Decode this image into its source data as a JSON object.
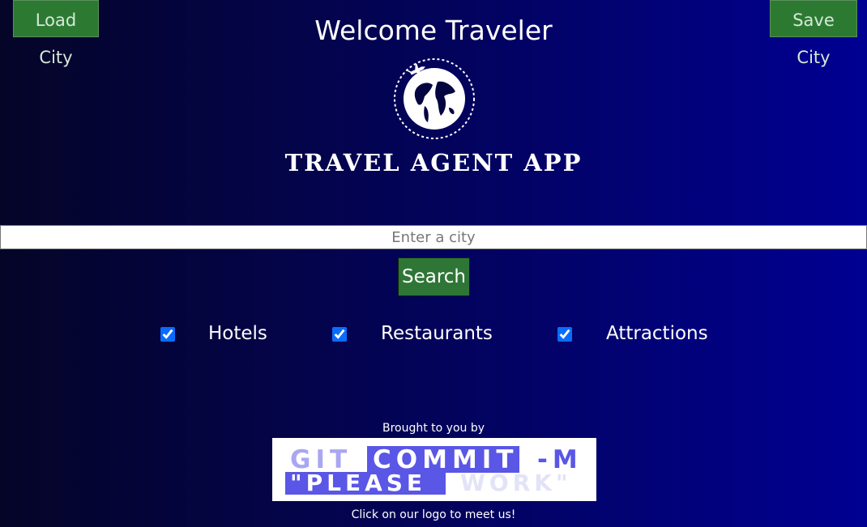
{
  "header": {
    "load_label": "Load City",
    "save_label": "Save City",
    "title": "Welcome Traveler",
    "app_name": "TRAVEL AGENT APP"
  },
  "search": {
    "placeholder": "Enter a city",
    "value": "",
    "button_label": "Search"
  },
  "filters": [
    {
      "label": "Hotels",
      "checked": true
    },
    {
      "label": "Restaurants",
      "checked": true
    },
    {
      "label": "Attractions",
      "checked": true
    }
  ],
  "footer": {
    "brought_by": "Brought to you by",
    "team_logo_text": "GIT COMMIT -M \"PLEASE WORK\"",
    "meet_us": "Click on our logo to meet us!"
  },
  "colors": {
    "button_green": "#2c7a32",
    "checkbox_blue": "#0a6cff",
    "team_logo_accent": "#5a56e6"
  },
  "icons": [
    "globe-airplane-icon"
  ]
}
